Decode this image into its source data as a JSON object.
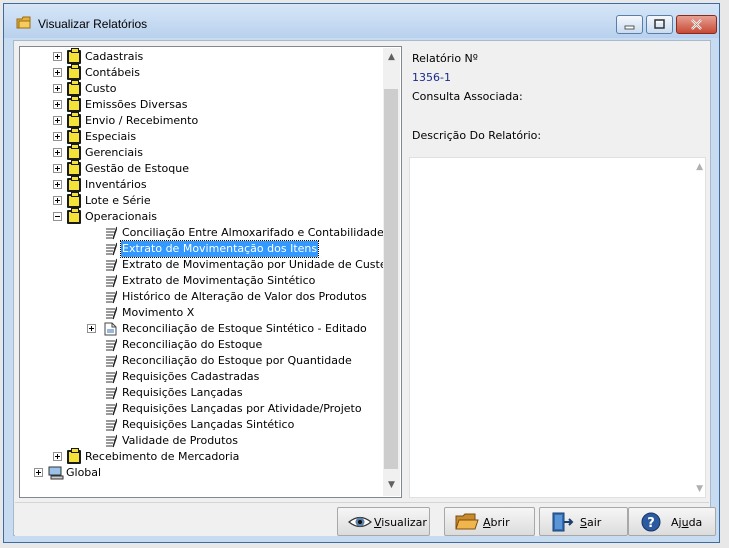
{
  "window": {
    "title": "Visualizar Relatórios"
  },
  "tree": {
    "items": [
      {
        "label": "Cadastrais",
        "type": "folder",
        "level": 1,
        "expander": "plus"
      },
      {
        "label": "Contábeis",
        "type": "folder",
        "level": 1,
        "expander": "plus"
      },
      {
        "label": "Custo",
        "type": "folder",
        "level": 1,
        "expander": "plus"
      },
      {
        "label": "Emissões Diversas",
        "type": "folder",
        "level": 1,
        "expander": "plus"
      },
      {
        "label": "Envio / Recebimento",
        "type": "folder",
        "level": 1,
        "expander": "plus"
      },
      {
        "label": "Especiais",
        "type": "folder",
        "level": 1,
        "expander": "plus"
      },
      {
        "label": "Gerenciais",
        "type": "folder",
        "level": 1,
        "expander": "plus"
      },
      {
        "label": "Gestão de Estoque",
        "type": "folder",
        "level": 1,
        "expander": "plus"
      },
      {
        "label": "Inventários",
        "type": "folder",
        "level": 1,
        "expander": "plus"
      },
      {
        "label": "Lote e Série",
        "type": "folder",
        "level": 1,
        "expander": "plus"
      },
      {
        "label": "Operacionais",
        "type": "folder",
        "level": 1,
        "expander": "minus"
      },
      {
        "label": "Conciliação Entre Almoxarifado e Contabilidade",
        "type": "report",
        "level": 2
      },
      {
        "label": "Extrato de Movimentação dos Itens",
        "type": "report",
        "level": 2,
        "selected": true
      },
      {
        "label": "Extrato de Movimentação por Unidade de Custeio",
        "type": "report",
        "level": 2
      },
      {
        "label": "Extrato de Movimentação Sintético",
        "type": "report",
        "level": 2
      },
      {
        "label": "Histórico de Alteração de Valor dos Produtos",
        "type": "report",
        "level": 2
      },
      {
        "label": "Movimento X",
        "type": "report",
        "level": 2
      },
      {
        "label": "Reconciliação de Estoque Sintético - Editado",
        "type": "report-doc",
        "level": 2,
        "expander": "plus"
      },
      {
        "label": "Reconciliação do Estoque",
        "type": "report",
        "level": 2
      },
      {
        "label": "Reconciliação do Estoque por Quantidade",
        "type": "report",
        "level": 2
      },
      {
        "label": "Requisições Cadastradas",
        "type": "report",
        "level": 2
      },
      {
        "label": "Requisições Lançadas",
        "type": "report",
        "level": 2
      },
      {
        "label": "Requisições Lançadas por Atividade/Projeto",
        "type": "report",
        "level": 2
      },
      {
        "label": "Requisições Lançadas Sintético",
        "type": "report",
        "level": 2
      },
      {
        "label": "Validade de Produtos",
        "type": "report",
        "level": 2
      },
      {
        "label": "Recebimento de Mercadoria",
        "type": "folder",
        "level": 1,
        "expander": "plus"
      },
      {
        "label": "Global",
        "type": "computer",
        "level": 0,
        "expander": "plus"
      }
    ]
  },
  "details": {
    "report_no_label": "Relatório Nº",
    "report_no_value": "1356-1",
    "query_label": "Consulta Associada:",
    "description_label": "Descrição Do Relatório:"
  },
  "buttons": {
    "view": {
      "pre": "",
      "key": "V",
      "post": "isualizar"
    },
    "open": {
      "pre": "",
      "key": "A",
      "post": "brir"
    },
    "exit": {
      "pre": "",
      "key": "S",
      "post": "air"
    },
    "help": {
      "pre": "Aj",
      "key": "u",
      "post": "da"
    }
  },
  "icons": {
    "app": "folder-app-icon",
    "folder": "folder-icon",
    "report": "report-pen-icon",
    "computer": "computer-icon",
    "view": "eye-icon",
    "open": "open-folder-icon",
    "exit": "exit-door-icon",
    "help": "help-icon"
  }
}
